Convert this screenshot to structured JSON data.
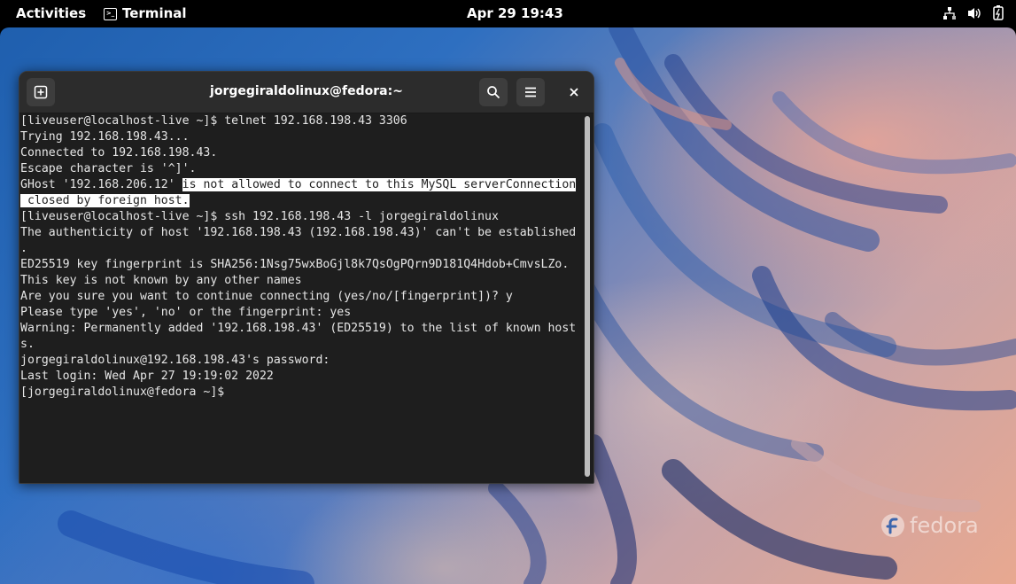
{
  "topbar": {
    "activities": "Activities",
    "app_name": "Terminal",
    "clock": "Apr 29  19:43"
  },
  "terminal": {
    "title": "jorgegiraldolinux@fedora:~",
    "lines": [
      "[liveuser@localhost-live ~]$ telnet 192.168.198.43 3306",
      "Trying 192.168.198.43...",
      "Connected to 192.168.198.43.",
      "Escape character is '^]'.",
      "",
      "",
      "[liveuser@localhost-live ~]$ ssh 192.168.198.43 -l jorgegiraldolinux",
      "The authenticity of host '192.168.198.43 (192.168.198.43)' can't be established",
      ".",
      "ED25519 key fingerprint is SHA256:1Nsg75wxBoGjl8k7QsOgPQrn9D181Q4Hdob+CmvsLZo.",
      "This key is not known by any other names",
      "Are you sure you want to continue connecting (yes/no/[fingerprint])? y",
      "Please type 'yes', 'no' or the fingerprint: yes",
      "Warning: Permanently added '192.168.198.43' (ED25519) to the list of known host",
      "s.",
      "jorgegiraldolinux@192.168.198.43's password:",
      "Last login: Wed Apr 27 19:19:02 2022",
      "[jorgegiraldolinux@fedora ~]$ "
    ],
    "line5_plain": "GHost '192.168.206.12' ",
    "line5_selected": "is not allowed to connect to this MySQL serverConnection",
    "line6_selected": " closed by foreign host."
  },
  "desktop": {
    "logo_text": "fedora"
  }
}
